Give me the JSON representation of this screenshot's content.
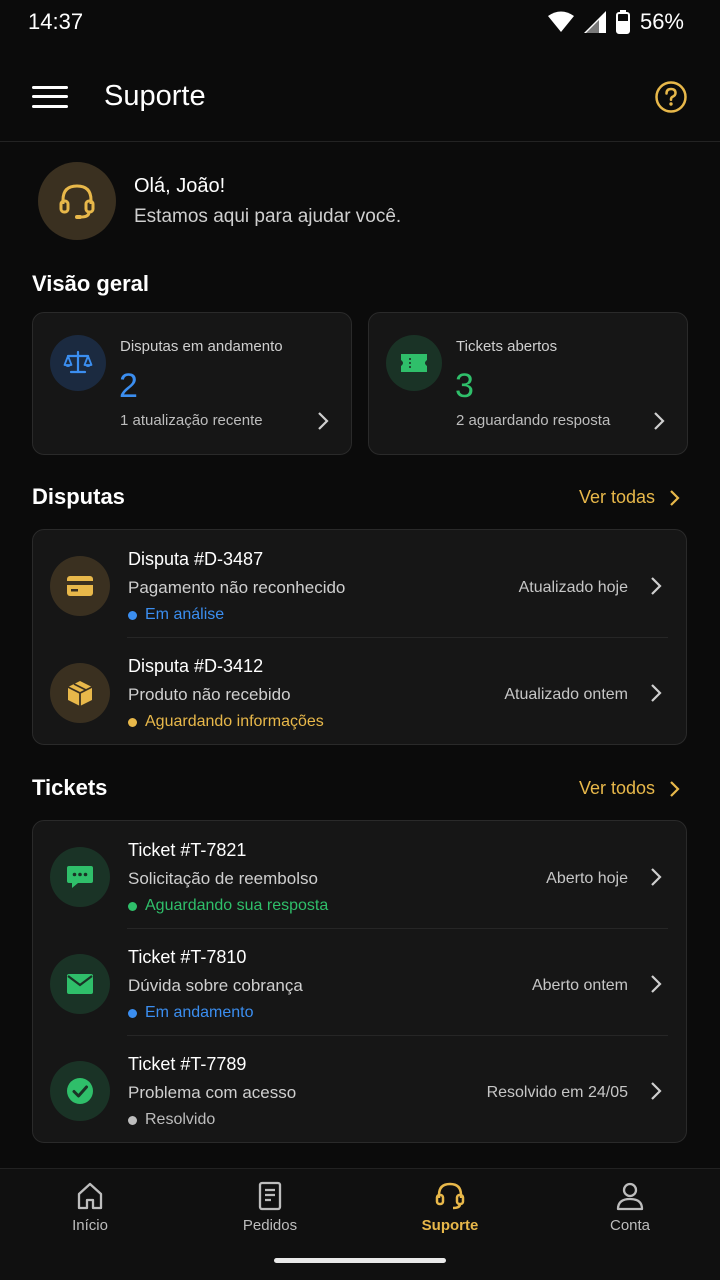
{
  "status_bar": {
    "time": "14:37",
    "battery": "56%"
  },
  "app_bar": {
    "title": "Suporte",
    "menu_icon": "hamburger-icon",
    "help_icon": "help-circle-icon"
  },
  "greeting": {
    "name": "Olá, João!",
    "subtitle": "Estamos aqui para ajudar você."
  },
  "overview": {
    "title": "Visão geral",
    "cards": [
      {
        "label": "Disputas em andamento",
        "value": "2",
        "note": "1 atualização recente",
        "icon": "scale-icon",
        "color": "#3b8ef0"
      },
      {
        "label": "Tickets abertos",
        "value": "3",
        "note": "2 aguardando resposta",
        "icon": "ticket-icon",
        "color": "#2fbf6a"
      }
    ]
  },
  "disputes": {
    "title": "Disputas",
    "see_all": "Ver todas",
    "items": [
      {
        "title": "Disputa #D-3487",
        "subtitle": "Pagamento não reconhecido",
        "status": "Em análise",
        "status_color": "#3b8ef0",
        "meta": "Atualizado hoje",
        "icon": "credit-card-icon"
      },
      {
        "title": "Disputa #D-3412",
        "subtitle": "Produto não recebido",
        "status": "Aguardando informações",
        "status_color": "#e8b84a",
        "meta": "Atualizado ontem",
        "icon": "package-icon"
      }
    ]
  },
  "tickets": {
    "title": "Tickets",
    "see_all": "Ver todos",
    "items": [
      {
        "title": "Ticket #T-7821",
        "subtitle": "Solicitação de reembolso",
        "status": "Aguardando sua resposta",
        "status_color": "#2fbf6a",
        "meta": "Aberto hoje",
        "icon": "chat-icon"
      },
      {
        "title": "Ticket #T-7810",
        "subtitle": "Dúvida sobre cobrança",
        "status": "Em andamento",
        "status_color": "#3b8ef0",
        "meta": "Aberto ontem",
        "icon": "mail-icon"
      },
      {
        "title": "Ticket #T-7789",
        "subtitle": "Problema com acesso",
        "status": "Resolvido",
        "status_color": "#bdbdbd",
        "meta": "Resolvido em 24/05",
        "icon": "check-circle-icon"
      }
    ]
  },
  "bottom_nav": [
    {
      "label": "Início",
      "icon": "home-icon",
      "active": false
    },
    {
      "label": "Pedidos",
      "icon": "receipt-icon",
      "active": false
    },
    {
      "label": "Suporte",
      "icon": "headset-icon",
      "active": true
    },
    {
      "label": "Conta",
      "icon": "user-icon",
      "active": false
    }
  ],
  "colors": {
    "accent": "#e8b84a",
    "blue": "#3b8ef0",
    "green": "#2fbf6a",
    "background": "#0b0b0b"
  }
}
